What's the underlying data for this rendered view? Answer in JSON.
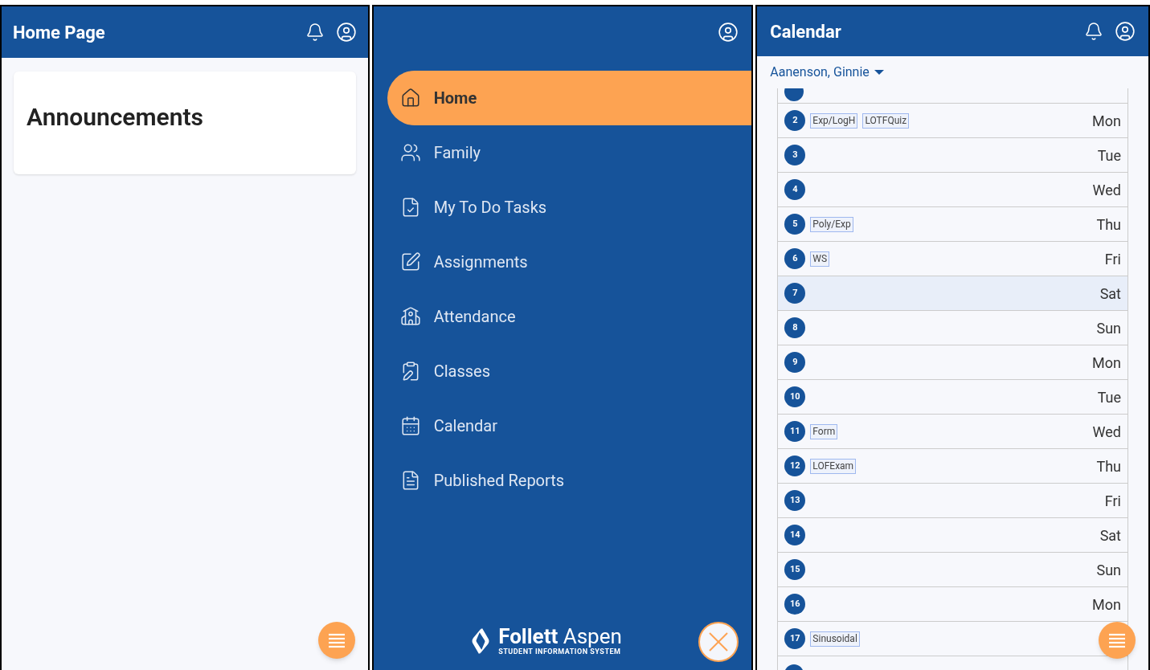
{
  "home_page": {
    "title": "Home Page",
    "card_title": "Announcements"
  },
  "nav_menu": {
    "items": [
      {
        "label": "Home",
        "selected": true
      },
      {
        "label": "Family",
        "selected": false
      },
      {
        "label": "My To Do Tasks",
        "selected": false
      },
      {
        "label": "Assignments",
        "selected": false
      },
      {
        "label": "Attendance",
        "selected": false
      },
      {
        "label": "Classes",
        "selected": false
      },
      {
        "label": "Calendar",
        "selected": false
      },
      {
        "label": "Published Reports",
        "selected": false
      }
    ],
    "logo": {
      "name": "**Follett** Aspen",
      "tagline": "STUDENT INFORMATION SYSTEM"
    }
  },
  "calendar": {
    "title": "Calendar",
    "student": "Aanenson, Ginnie",
    "days": [
      {
        "number": "2",
        "day": "Mon",
        "tags": [
          "Exp/LogH",
          "LOTFQuiz"
        ],
        "selected": false
      },
      {
        "number": "3",
        "day": "Tue",
        "selected": false
      },
      {
        "number": "4",
        "day": "Wed",
        "selected": false
      },
      {
        "number": "5",
        "day": "Thu",
        "tags": [
          "Poly/Exp"
        ],
        "selected": false
      },
      {
        "number": "6",
        "day": "Fri",
        "tags": [
          "WS"
        ],
        "selected": false
      },
      {
        "number": "7",
        "day": "Sat",
        "selected": true
      },
      {
        "number": "8",
        "day": "Sun",
        "selected": false
      },
      {
        "number": "9",
        "day": "Mon",
        "selected": false
      },
      {
        "number": "10",
        "day": "Tue",
        "selected": false
      },
      {
        "number": "11",
        "day": "Wed",
        "tags": [
          "Form"
        ],
        "selected": false
      },
      {
        "number": "12",
        "day": "Thu",
        "tags": [
          "LOFExam"
        ],
        "selected": false
      },
      {
        "number": "13",
        "day": "Fri",
        "selected": false
      },
      {
        "number": "14",
        "day": "Sat",
        "selected": false
      },
      {
        "number": "15",
        "day": "Sun",
        "selected": false
      },
      {
        "number": "16",
        "day": "Mon",
        "selected": false
      },
      {
        "number": "17",
        "tags": [
          "Sinusoidal"
        ],
        "selected": false
      }
    ]
  }
}
